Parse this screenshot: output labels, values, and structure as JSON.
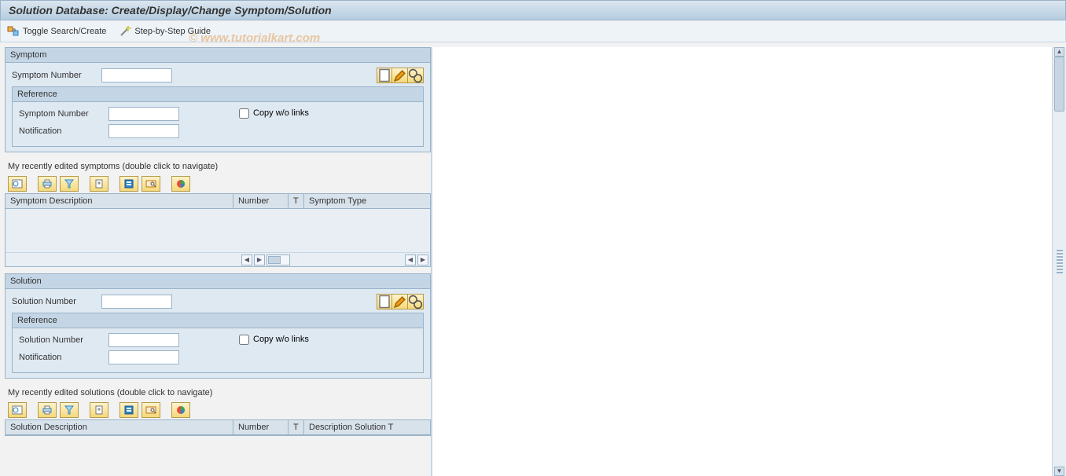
{
  "title": "Solution Database:  Create/Display/Change Symptom/Solution",
  "watermark": "© www.tutorialkart.com",
  "toolbar": {
    "toggle_label": "Toggle Search/Create",
    "guide_label": "Step-by-Step Guide"
  },
  "symptom": {
    "group_title": "Symptom",
    "number_label": "Symptom Number",
    "number_value": "",
    "reference": {
      "title": "Reference",
      "number_label": "Symptom Number",
      "number_value": "",
      "notification_label": "Notification",
      "notification_value": "",
      "copy_label": "Copy w/o links",
      "copy_checked": false
    },
    "recent_label": "My recently edited symptoms (double click to navigate)",
    "columns": {
      "description": "Symptom Description",
      "number": "Number",
      "t": "T",
      "type": "Symptom Type"
    }
  },
  "solution": {
    "group_title": "Solution",
    "number_label": "Solution Number",
    "number_value": "",
    "reference": {
      "title": "Reference",
      "number_label": "Solution Number",
      "number_value": "",
      "notification_label": "Notification",
      "notification_value": "",
      "copy_label": "Copy w/o links",
      "copy_checked": false
    },
    "recent_label": "My recently edited solutions (double click to navigate)",
    "columns": {
      "description": "Solution Description",
      "number": "Number",
      "t": "T",
      "type": "Description Solution T"
    }
  },
  "alv_icons": [
    "details",
    "print",
    "filter",
    "export",
    "layout",
    "search",
    "graphic"
  ]
}
